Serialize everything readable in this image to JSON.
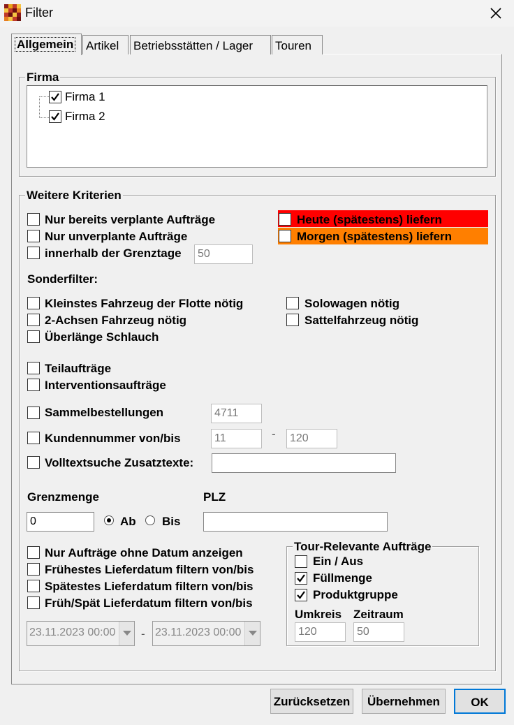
{
  "window": {
    "title": "Filter"
  },
  "tabs": [
    "Allgemein",
    "Artikel",
    "Betriebsstätten / Lager",
    "Touren"
  ],
  "firma": {
    "legend": "Firma",
    "items": [
      {
        "label": "Firma 1",
        "checked": true
      },
      {
        "label": "Firma 2",
        "checked": true
      }
    ]
  },
  "kriterien": {
    "legend": "Weitere Kriterien",
    "nur_verplant": "Nur bereits verplante Aufträge",
    "nur_unverplant": "Nur unverplante Aufträge",
    "grenztage": "innerhalb der Grenztage",
    "grenztage_value": "50",
    "heute": "Heute (spätestens) liefern",
    "morgen": "Morgen (spätestens) liefern",
    "heute_color": "#ff0000",
    "morgen_color": "#ff7f00",
    "sonderfilter": "Sonderfilter:",
    "kleinstes": "Kleinstes Fahrzeug der Flotte nötig",
    "achsen": "2-Achsen Fahrzeug nötig",
    "ueberlaenge": "Überlänge Schlauch",
    "solowagen": "Solowagen nötig",
    "sattel": "Sattelfahrzeug nötig",
    "teilauftraege": "Teilaufträge",
    "intervention": "Interventionsaufträge",
    "sammel": "Sammelbestellungen",
    "sammel_value": "4711",
    "kunden": "Kundennummer von/bis",
    "kunden_von": "11",
    "kunden_dash": "-",
    "kunden_bis": "120",
    "volltext": "Volltextsuche Zusatztexte:",
    "volltext_value": ""
  },
  "grenzmenge": {
    "label": "Grenzmenge",
    "value": "0",
    "ab": "Ab",
    "bis": "Bis",
    "selected": "Ab"
  },
  "plz": {
    "label": "PLZ",
    "value": ""
  },
  "datum": {
    "ohne_datum": "Nur Aufträge ohne Datum anzeigen",
    "fruehestes": "Frühestes Lieferdatum filtern von/bis",
    "spaetestes": "Spätestes Lieferdatum filtern von/bis",
    "frueh_spaet": "Früh/Spät Lieferdatum filtern von/bis",
    "von": "23.11.2023 00:00",
    "dash": "-",
    "bis": "23.11.2023 00:00"
  },
  "tour": {
    "legend": "Tour-Relevante Aufträge",
    "ein_aus": "Ein / Aus",
    "ein_aus_checked": false,
    "fuellmenge": "Füllmenge",
    "fuellmenge_checked": true,
    "produktgruppe": "Produktgruppe",
    "produktgruppe_checked": true,
    "umkreis": "Umkreis",
    "umkreis_value": "120",
    "zeitraum": "Zeitraum",
    "zeitraum_value": "50"
  },
  "buttons": {
    "reset": "Zurücksetzen",
    "apply": "Übernehmen",
    "ok": "OK"
  }
}
